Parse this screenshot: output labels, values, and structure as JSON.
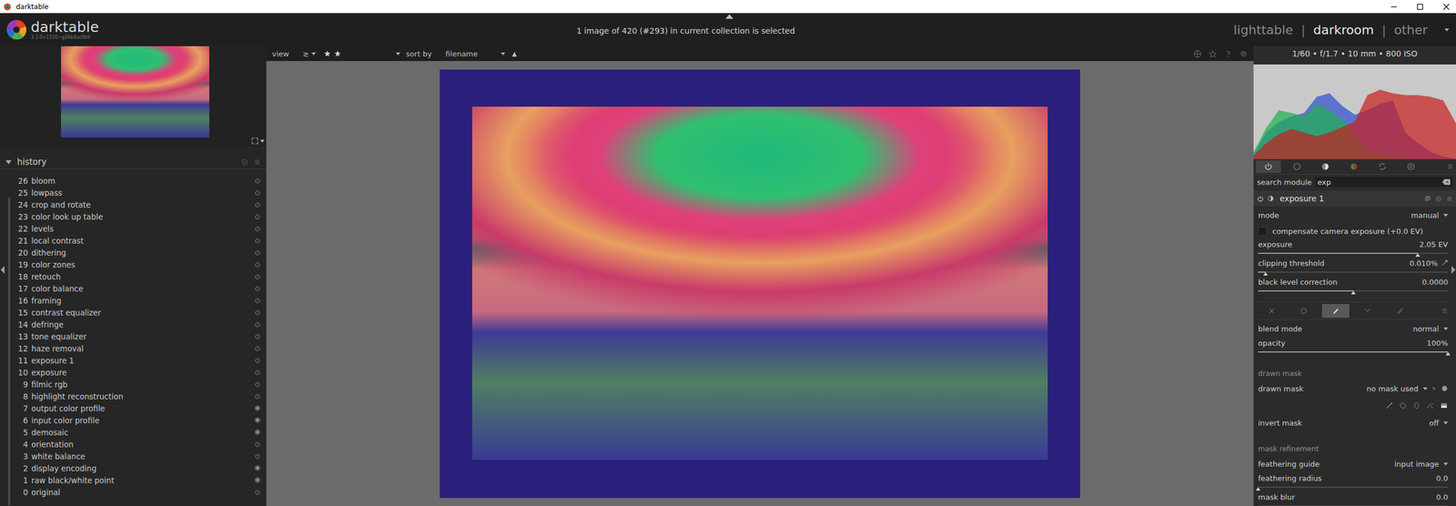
{
  "window": {
    "title": "darktable"
  },
  "header": {
    "logo": "darktable",
    "version": "3.3.0+1520~g26b4ac9b9",
    "collection": "1 image of 420 (#293) in current collection is selected",
    "views": [
      {
        "label": "lighttable",
        "selected": false
      },
      {
        "label": "darkroom",
        "selected": true
      },
      {
        "label": "other",
        "selected": false
      }
    ],
    "separator": "|"
  },
  "toolbar": {
    "view_label": "view",
    "comparator": "≥",
    "stars": 2,
    "sort_label": "sort by",
    "sort_value": "filename",
    "sort_order": "▲"
  },
  "history": {
    "title": "history",
    "items": [
      {
        "num": "26",
        "name": "bloom",
        "always_on": false
      },
      {
        "num": "25",
        "name": "lowpass",
        "always_on": false
      },
      {
        "num": "24",
        "name": "crop and rotate",
        "always_on": false
      },
      {
        "num": "23",
        "name": "color look up table",
        "always_on": false
      },
      {
        "num": "22",
        "name": "levels",
        "always_on": false
      },
      {
        "num": "21",
        "name": "local contrast",
        "always_on": false
      },
      {
        "num": "20",
        "name": "dithering",
        "always_on": false
      },
      {
        "num": "19",
        "name": "color zones",
        "always_on": false
      },
      {
        "num": "18",
        "name": "retouch",
        "always_on": false
      },
      {
        "num": "17",
        "name": "color balance",
        "always_on": false
      },
      {
        "num": "16",
        "name": "framing",
        "always_on": false
      },
      {
        "num": "15",
        "name": "contrast equalizer",
        "always_on": false
      },
      {
        "num": "14",
        "name": "defringe",
        "always_on": false
      },
      {
        "num": "13",
        "name": "tone equalizer",
        "always_on": false
      },
      {
        "num": "12",
        "name": "haze removal",
        "always_on": false
      },
      {
        "num": "11",
        "name": "exposure 1",
        "always_on": false
      },
      {
        "num": "10",
        "name": "exposure",
        "always_on": false
      },
      {
        "num": "9",
        "name": "filmic rgb",
        "always_on": false
      },
      {
        "num": "8",
        "name": "highlight reconstruction",
        "always_on": false
      },
      {
        "num": "7",
        "name": "output color profile",
        "always_on": true
      },
      {
        "num": "6",
        "name": "input color profile",
        "always_on": true
      },
      {
        "num": "5",
        "name": "demosaic",
        "always_on": true
      },
      {
        "num": "4",
        "name": "orientation",
        "always_on": false
      },
      {
        "num": "3",
        "name": "white balance",
        "always_on": false
      },
      {
        "num": "2",
        "name": "display encoding",
        "always_on": true
      },
      {
        "num": "1",
        "name": "raw black/white point",
        "always_on": true
      },
      {
        "num": "0",
        "name": "original",
        "always_on": false
      }
    ]
  },
  "image_info": "1/60 • f/1.7 • 10 mm • 800 ISO",
  "histogram": {
    "series": [
      {
        "name": "blue",
        "color": "#2d4fd0",
        "values": [
          0.05,
          0.3,
          0.42,
          0.48,
          0.52,
          0.7,
          0.74,
          0.6,
          0.5,
          0.55,
          0.62,
          0.66,
          0.3,
          0.18,
          0.08,
          0.03,
          0
        ]
      },
      {
        "name": "green",
        "color": "#20b050",
        "values": [
          0.08,
          0.35,
          0.55,
          0.52,
          0.48,
          0.62,
          0.55,
          0.45,
          0.28,
          0.1,
          0.05,
          0.02,
          0.01,
          0,
          0,
          0,
          0
        ]
      },
      {
        "name": "red",
        "color": "#c81e1e",
        "values": [
          0.04,
          0.18,
          0.28,
          0.34,
          0.3,
          0.26,
          0.3,
          0.36,
          0.42,
          0.72,
          0.78,
          0.74,
          0.72,
          0.72,
          0.7,
          0.66,
          0.4
        ]
      }
    ]
  },
  "module_groups": [
    {
      "selected": true
    },
    {
      "selected": false
    },
    {
      "selected": false
    },
    {
      "selected": false
    },
    {
      "selected": false
    },
    {
      "selected": false
    }
  ],
  "search": {
    "label": "search module",
    "value": "exp"
  },
  "module": {
    "name": "exposure 1",
    "enabled": true,
    "params": [
      {
        "kind": "dropdown",
        "label": "mode",
        "value": "manual"
      },
      {
        "kind": "checkbox",
        "label": "compensate camera exposure (+0.0 EV)",
        "checked": false
      },
      {
        "kind": "slider",
        "label": "exposure",
        "value": "2.05 EV",
        "level": 0.84,
        "picker": false
      },
      {
        "kind": "slider",
        "label": "clipping threshold",
        "value": "0.010%",
        "level": 0.04,
        "picker": true
      },
      {
        "kind": "slider",
        "label": "black level correction",
        "value": "0.0000",
        "level": 0.5,
        "picker": false
      }
    ],
    "blend_tabs": [
      {
        "selected": false
      },
      {
        "selected": false
      },
      {
        "selected": true
      },
      {
        "selected": false
      },
      {
        "selected": false
      }
    ],
    "blend_params": [
      {
        "kind": "dropdown",
        "label": "blend mode",
        "value": "normal"
      },
      {
        "kind": "slider",
        "label": "opacity",
        "value": "100%",
        "level": 1,
        "picker": false
      },
      {
        "kind": "section",
        "label": "drawn mask"
      },
      {
        "kind": "maskdropdown",
        "label": "drawn mask",
        "value": "no mask used"
      },
      {
        "kind": "shapes"
      },
      {
        "kind": "dropdown",
        "label": "invert mask",
        "value": "off"
      },
      {
        "kind": "section",
        "label": "mask refinement"
      },
      {
        "kind": "dropdown",
        "label": "feathering guide",
        "value": "input image"
      },
      {
        "kind": "slider",
        "label": "feathering radius",
        "value": "0.0",
        "level": 0,
        "picker": false
      },
      {
        "kind": "slider",
        "label": "mask blur",
        "value": "0.0",
        "level": 0,
        "picker": false
      }
    ]
  }
}
